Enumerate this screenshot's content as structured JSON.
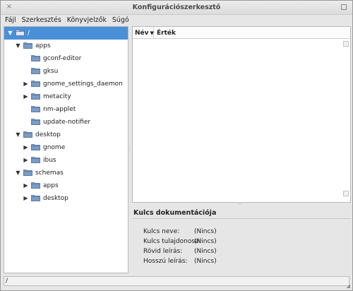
{
  "window": {
    "title": "Konfigurációszerkesztő",
    "close_glyph": "×"
  },
  "menubar": {
    "items": [
      "Fájl",
      "Szerkesztés",
      "Könyvjelzők",
      "Súgó"
    ]
  },
  "tree": {
    "rows": [
      {
        "label": "/",
        "expander": "expanded",
        "selected": true,
        "depth": 0
      },
      {
        "label": "apps",
        "expander": "expanded",
        "selected": false,
        "depth": 1
      },
      {
        "label": "gconf-editor",
        "expander": "none",
        "selected": false,
        "depth": 2
      },
      {
        "label": "gksu",
        "expander": "none",
        "selected": false,
        "depth": 2
      },
      {
        "label": "gnome_settings_daemon",
        "expander": "collapsed",
        "selected": false,
        "depth": 2
      },
      {
        "label": "metacity",
        "expander": "collapsed",
        "selected": false,
        "depth": 2
      },
      {
        "label": "nm-applet",
        "expander": "none",
        "selected": false,
        "depth": 2
      },
      {
        "label": "update-notifier",
        "expander": "none",
        "selected": false,
        "depth": 2
      },
      {
        "label": "desktop",
        "expander": "expanded",
        "selected": false,
        "depth": 1
      },
      {
        "label": "gnome",
        "expander": "collapsed",
        "selected": false,
        "depth": 2
      },
      {
        "label": "ibus",
        "expander": "collapsed",
        "selected": false,
        "depth": 2
      },
      {
        "label": "schemas",
        "expander": "expanded",
        "selected": false,
        "depth": 1
      },
      {
        "label": "apps",
        "expander": "collapsed",
        "selected": false,
        "depth": 2
      },
      {
        "label": "desktop",
        "expander": "collapsed",
        "selected": false,
        "depth": 2
      }
    ]
  },
  "list": {
    "col_name": "Név",
    "col_value": "Érték",
    "sort_glyph": "▼"
  },
  "doc": {
    "title": "Kulcs dokumentációja",
    "fields": [
      {
        "label": "Kulcs neve:",
        "value": "(Nincs)"
      },
      {
        "label": "Kulcs tulajdonosa:",
        "value": "(Nincs)"
      },
      {
        "label": "Rövid leírás:",
        "value": "(Nincs)"
      },
      {
        "label": "Hosszú leírás:",
        "value": "(Nincs)"
      }
    ]
  },
  "statusbar": {
    "text": "/"
  },
  "colors": {
    "selection": "#4a90d9",
    "folder": "#7a9cc6"
  }
}
